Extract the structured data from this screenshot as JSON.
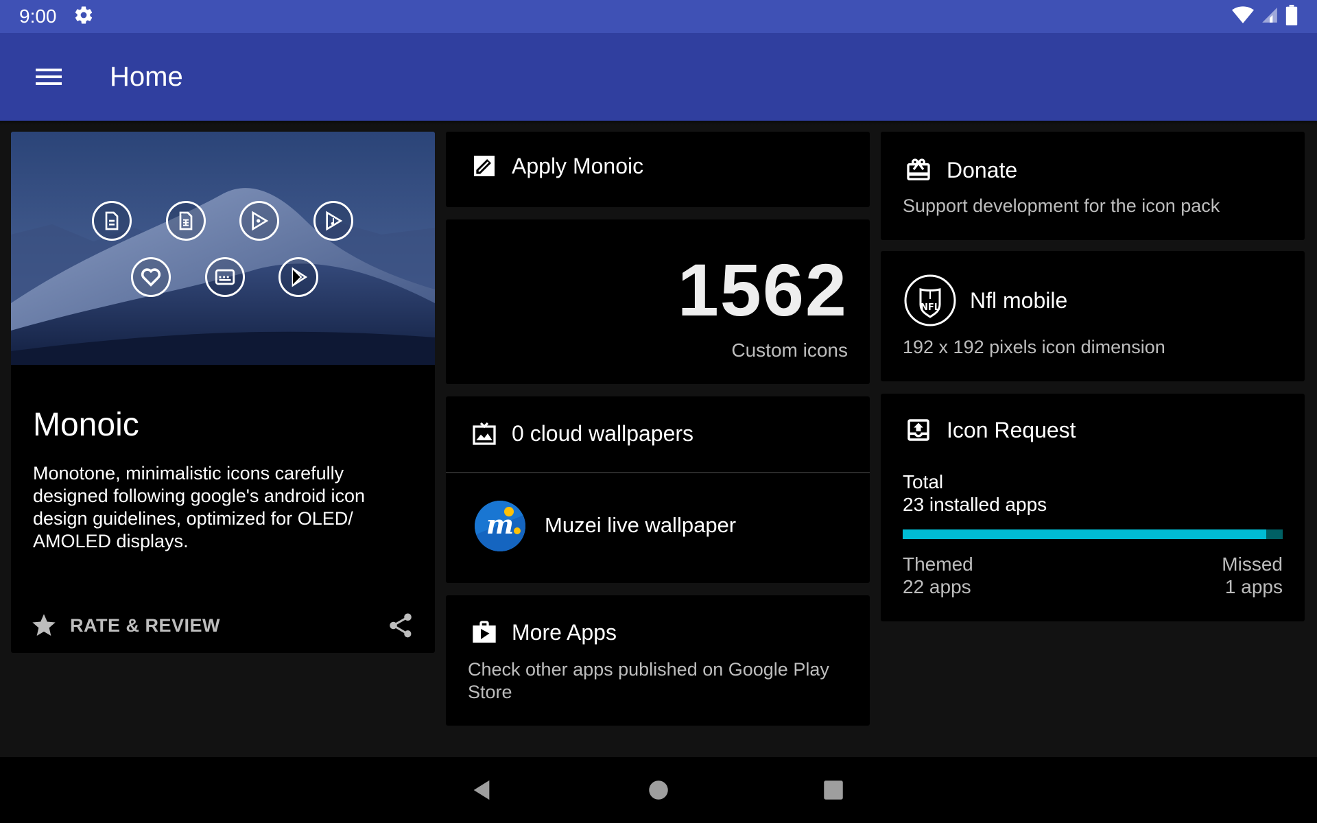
{
  "status_bar": {
    "time": "9:00",
    "icons": [
      "gear-icon",
      "wifi-icon",
      "signal-icon",
      "battery-icon"
    ]
  },
  "toolbar": {
    "title": "Home",
    "menu_icon": "hamburger-menu-icon"
  },
  "colors": {
    "status_bar": "#3f51b5",
    "toolbar": "#303f9f",
    "background": "#121212",
    "card": "#000000",
    "progress_fill": "#00bcd4",
    "progress_track": "#006064"
  },
  "app_card": {
    "name": "Monoic",
    "description": "Monotone, minimalistic icons carefully designed following google's android icon design guidelines, optimized for OLED/ AMOLED displays.",
    "rate_label": "RATE & REVIEW",
    "rate_icon": "star-icon",
    "share_icon": "share-icon",
    "preview_icons": [
      "docs-icon",
      "sheets-icon",
      "play-games-icon",
      "play-music-icon",
      "fit-heart-icon",
      "gboard-icon",
      "play-store-icon"
    ]
  },
  "apply_card": {
    "title": "Apply Monoic",
    "icon": "apply-edit-icon"
  },
  "icons_card": {
    "count": "1562",
    "caption": "Custom icons"
  },
  "wallpapers_card": {
    "title": "0 cloud wallpapers",
    "icon": "wallpaper-image-icon",
    "muzei_label": "Muzei live wallpaper",
    "muzei_icon": "muzei-logo-icon"
  },
  "more_apps_card": {
    "title": "More Apps",
    "subtitle": "Check other apps published on Google Play Store",
    "icon": "play-bag-icon"
  },
  "donate_card": {
    "title": "Donate",
    "subtitle": "Support development for the icon pack",
    "icon": "gift-card-icon"
  },
  "random_icon_card": {
    "title": "Nfl mobile",
    "subtitle": "192 x 192 pixels icon dimension",
    "icon": "nfl-icon"
  },
  "icon_request_card": {
    "title": "Icon Request",
    "icon": "icon-request-upload-icon",
    "total_label": "Total",
    "total_value": "23 installed apps",
    "progress_percent": 95.6,
    "themed_label": "Themed",
    "themed_value": "22 apps",
    "missed_label": "Missed",
    "missed_value": "1 apps"
  },
  "nav_bar": {
    "icons": [
      "back-icon",
      "home-icon",
      "recents-icon"
    ]
  }
}
